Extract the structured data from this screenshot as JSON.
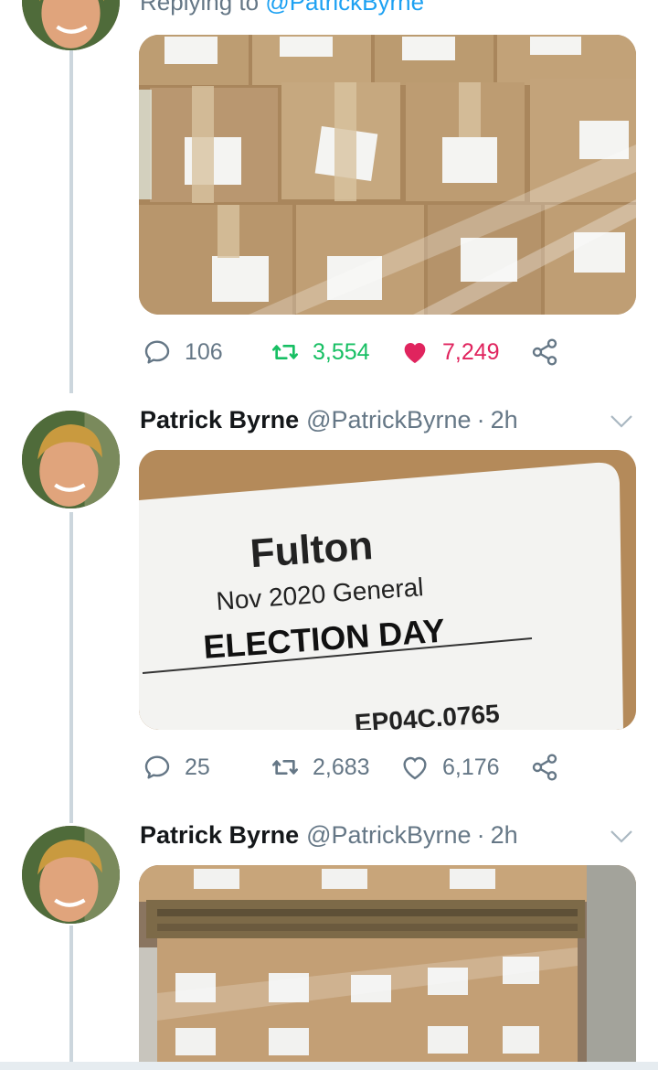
{
  "reply": {
    "prefix": "Replying to",
    "handle": "@PatrickByrne"
  },
  "tweets": [
    {
      "stats": {
        "replies": "106",
        "retweets": "3,554",
        "likes": "7,249"
      },
      "liked": true,
      "retweeted": true
    },
    {
      "author": {
        "name": "Patrick Byrne",
        "handle": "@PatrickByrne",
        "time": "2h"
      },
      "media_text": {
        "line1": "Fulton",
        "line2": "Nov 2020 General",
        "line3": "ELECTION DAY",
        "line4": "EP04C.0765"
      },
      "stats": {
        "replies": "25",
        "retweets": "2,683",
        "likes": "6,176"
      },
      "liked": false,
      "retweeted": false
    },
    {
      "author": {
        "name": "Patrick Byrne",
        "handle": "@PatrickByrne",
        "time": "2h"
      }
    }
  ],
  "colors": {
    "link": "#1da1f2",
    "retweet_active": "#17bf63",
    "like_active": "#e0245e",
    "muted": "#657786"
  },
  "icons": {
    "reply": "reply-icon",
    "retweet": "retweet-icon",
    "like": "heart-icon",
    "share": "share-icon",
    "more": "chevron-down-icon"
  }
}
